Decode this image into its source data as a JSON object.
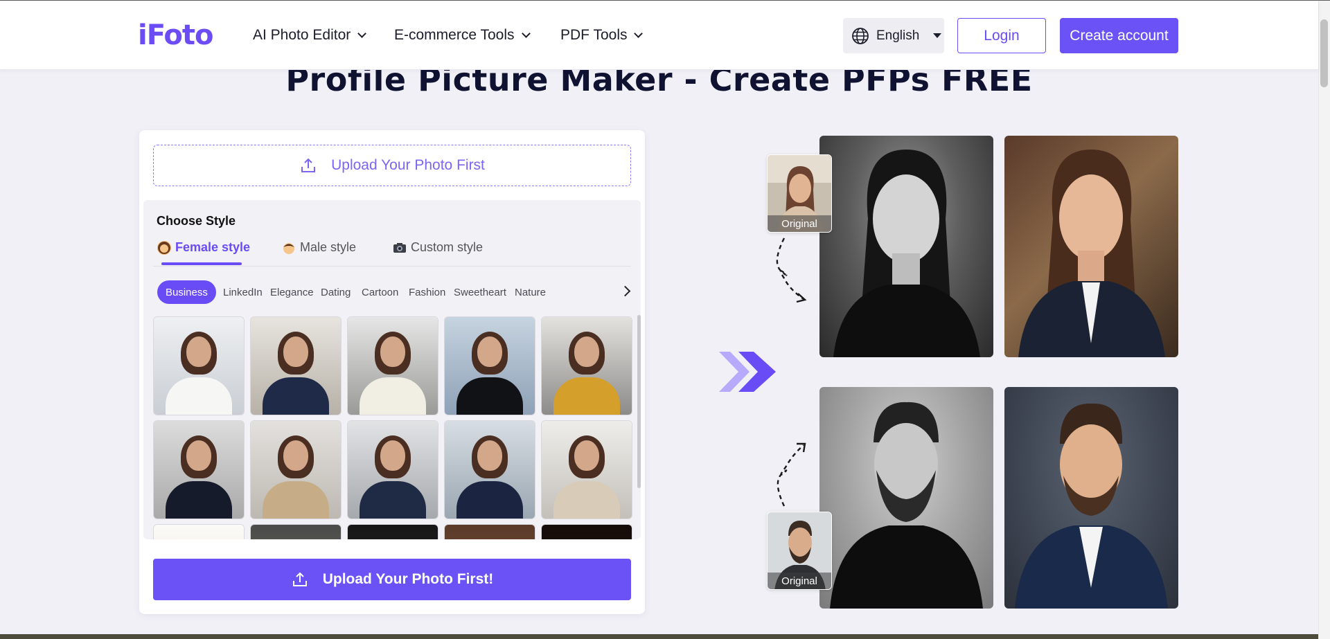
{
  "header": {
    "logo_text": "iFoto",
    "nav": [
      {
        "label": "AI Photo Editor"
      },
      {
        "label": "E-commerce Tools"
      },
      {
        "label": "PDF Tools"
      }
    ],
    "language": "English",
    "login_label": "Login",
    "create_account_label": "Create account"
  },
  "page_title": "Profile Picture Maker - Create PFPs FREE",
  "panel": {
    "upload_top_label": "Upload Your Photo First",
    "choose_style_label": "Choose Style",
    "tabs": [
      {
        "label": "Female style",
        "active": true,
        "icon": "woman-emoji-icon"
      },
      {
        "label": "Male style",
        "active": false,
        "icon": "man-emoji-icon"
      },
      {
        "label": "Custom style",
        "active": false,
        "icon": "camera-emoji-icon"
      }
    ],
    "categories": [
      "Business",
      "LinkedIn",
      "Elegance",
      "Dating",
      "Cartoon",
      "Fashion",
      "Sweetheart",
      "Nature"
    ],
    "active_category": "Business",
    "upload_bottom_label": "Upload Your Photo First!"
  },
  "showcase": {
    "original_label_top": "Original",
    "original_label_bottom": "Original"
  },
  "colors": {
    "accent": "#6a52f6",
    "background": "#f1f0f6"
  }
}
